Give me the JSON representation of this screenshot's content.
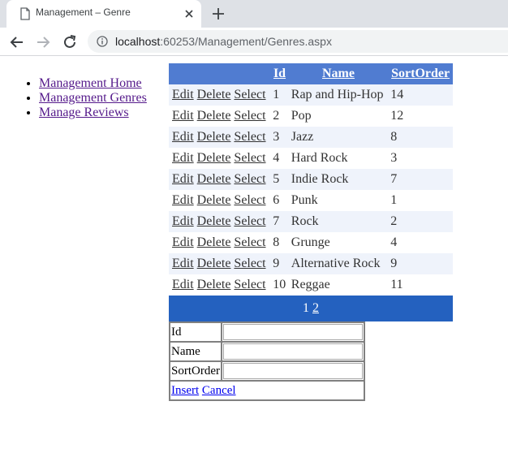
{
  "browser": {
    "tab_title": "Management – Genre",
    "url_host": "localhost",
    "url_rest": ":60253/Management/Genres.aspx"
  },
  "nav": {
    "items": [
      {
        "label": "Management Home"
      },
      {
        "label": "Management Genres"
      },
      {
        "label": "Manage Reviews"
      }
    ]
  },
  "grid": {
    "headers": {
      "id": "Id",
      "name": "Name",
      "sort_order": "SortOrder"
    },
    "ops": {
      "edit": "Edit",
      "delete": "Delete",
      "select": "Select"
    },
    "rows": [
      {
        "id": "1",
        "name": "Rap and Hip-Hop",
        "sort_order": "14"
      },
      {
        "id": "2",
        "name": "Pop",
        "sort_order": "12"
      },
      {
        "id": "3",
        "name": "Jazz",
        "sort_order": "8"
      },
      {
        "id": "4",
        "name": "Hard Rock",
        "sort_order": "3"
      },
      {
        "id": "5",
        "name": "Indie Rock",
        "sort_order": "7"
      },
      {
        "id": "6",
        "name": "Punk",
        "sort_order": "1"
      },
      {
        "id": "7",
        "name": "Rock",
        "sort_order": "2"
      },
      {
        "id": "8",
        "name": "Grunge",
        "sort_order": "4"
      },
      {
        "id": "9",
        "name": "Alternative Rock",
        "sort_order": "9"
      },
      {
        "id": "10",
        "name": "Reggae",
        "sort_order": "11"
      }
    ],
    "pager": {
      "current": "1",
      "next": "2"
    }
  },
  "insert_form": {
    "fields": [
      {
        "label": "Id",
        "value": ""
      },
      {
        "label": "Name",
        "value": ""
      },
      {
        "label": "SortOrder",
        "value": ""
      }
    ],
    "insert_label": "Insert",
    "cancel_label": "Cancel"
  },
  "colors": {
    "header_bg": "#507cd1",
    "alt_row_bg": "#eff3fb",
    "pager_bg": "#2461bf",
    "visited_link": "#551a8b"
  }
}
